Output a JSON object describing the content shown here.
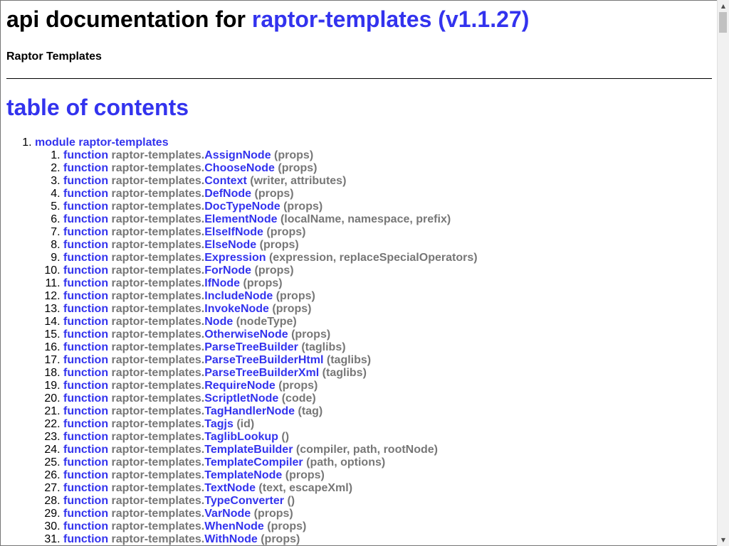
{
  "header": {
    "title_prefix": "api documentation for ",
    "title_link": "raptor-templates (v1.1.27)",
    "subtitle": "Raptor Templates"
  },
  "toc": {
    "title": "table of contents",
    "modules": [
      {
        "label": "module raptor-templates",
        "functions": [
          {
            "kw": "function",
            "ns": "raptor-templates.",
            "name": "AssignNode",
            "args": "(props)"
          },
          {
            "kw": "function",
            "ns": "raptor-templates.",
            "name": "ChooseNode",
            "args": "(props)"
          },
          {
            "kw": "function",
            "ns": "raptor-templates.",
            "name": "Context",
            "args": "(writer, attributes)"
          },
          {
            "kw": "function",
            "ns": "raptor-templates.",
            "name": "DefNode",
            "args": "(props)"
          },
          {
            "kw": "function",
            "ns": "raptor-templates.",
            "name": "DocTypeNode",
            "args": "(props)"
          },
          {
            "kw": "function",
            "ns": "raptor-templates.",
            "name": "ElementNode",
            "args": "(localName, namespace, prefix)"
          },
          {
            "kw": "function",
            "ns": "raptor-templates.",
            "name": "ElseIfNode",
            "args": "(props)"
          },
          {
            "kw": "function",
            "ns": "raptor-templates.",
            "name": "ElseNode",
            "args": "(props)"
          },
          {
            "kw": "function",
            "ns": "raptor-templates.",
            "name": "Expression",
            "args": "(expression, replaceSpecialOperators)"
          },
          {
            "kw": "function",
            "ns": "raptor-templates.",
            "name": "ForNode",
            "args": "(props)"
          },
          {
            "kw": "function",
            "ns": "raptor-templates.",
            "name": "IfNode",
            "args": "(props)"
          },
          {
            "kw": "function",
            "ns": "raptor-templates.",
            "name": "IncludeNode",
            "args": "(props)"
          },
          {
            "kw": "function",
            "ns": "raptor-templates.",
            "name": "InvokeNode",
            "args": "(props)"
          },
          {
            "kw": "function",
            "ns": "raptor-templates.",
            "name": "Node",
            "args": "(nodeType)"
          },
          {
            "kw": "function",
            "ns": "raptor-templates.",
            "name": "OtherwiseNode",
            "args": "(props)"
          },
          {
            "kw": "function",
            "ns": "raptor-templates.",
            "name": "ParseTreeBuilder",
            "args": "(taglibs)"
          },
          {
            "kw": "function",
            "ns": "raptor-templates.",
            "name": "ParseTreeBuilderHtml",
            "args": "(taglibs)"
          },
          {
            "kw": "function",
            "ns": "raptor-templates.",
            "name": "ParseTreeBuilderXml",
            "args": "(taglibs)"
          },
          {
            "kw": "function",
            "ns": "raptor-templates.",
            "name": "RequireNode",
            "args": "(props)"
          },
          {
            "kw": "function",
            "ns": "raptor-templates.",
            "name": "ScriptletNode",
            "args": "(code)"
          },
          {
            "kw": "function",
            "ns": "raptor-templates.",
            "name": "TagHandlerNode",
            "args": "(tag)"
          },
          {
            "kw": "function",
            "ns": "raptor-templates.",
            "name": "Tagjs",
            "args": "(id)"
          },
          {
            "kw": "function",
            "ns": "raptor-templates.",
            "name": "TaglibLookup",
            "args": "()"
          },
          {
            "kw": "function",
            "ns": "raptor-templates.",
            "name": "TemplateBuilder",
            "args": "(compiler, path, rootNode)"
          },
          {
            "kw": "function",
            "ns": "raptor-templates.",
            "name": "TemplateCompiler",
            "args": "(path, options)"
          },
          {
            "kw": "function",
            "ns": "raptor-templates.",
            "name": "TemplateNode",
            "args": "(props)"
          },
          {
            "kw": "function",
            "ns": "raptor-templates.",
            "name": "TextNode",
            "args": "(text, escapeXml)"
          },
          {
            "kw": "function",
            "ns": "raptor-templates.",
            "name": "TypeConverter",
            "args": "()"
          },
          {
            "kw": "function",
            "ns": "raptor-templates.",
            "name": "VarNode",
            "args": "(props)"
          },
          {
            "kw": "function",
            "ns": "raptor-templates.",
            "name": "WhenNode",
            "args": "(props)"
          },
          {
            "kw": "function",
            "ns": "raptor-templates.",
            "name": "WithNode",
            "args": "(props)"
          }
        ]
      }
    ]
  },
  "scrollbar": {
    "up_icon": "triangle-up-icon",
    "down_icon": "triangle-down-icon"
  },
  "colors": {
    "link": "#3333ee",
    "muted": "#777777",
    "text": "#000000"
  }
}
